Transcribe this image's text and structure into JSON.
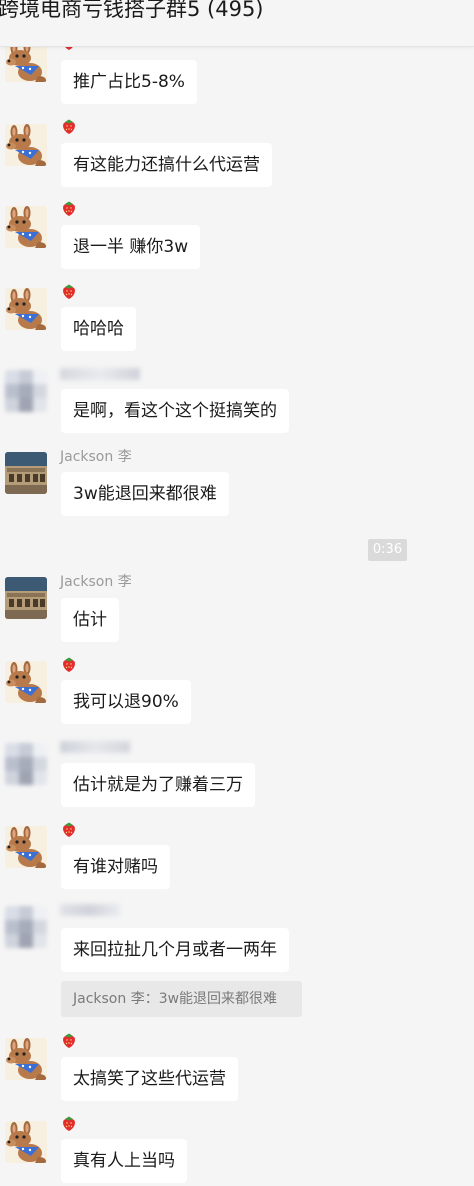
{
  "header": {
    "title": "跨境电商亏钱搭子群5 (495)"
  },
  "colors": {
    "background": "#f5f5f5",
    "bubble": "#ffffff",
    "quote": "#e8e8e8",
    "time_badge": "#dadada",
    "nickname": "#9a9a9a"
  },
  "messages": [
    {
      "sender": "",
      "avatar": "kangaroo-icon",
      "text": "推广占比5-8%"
    },
    {
      "sender": "",
      "avatar": "kangaroo-icon",
      "text": "有这能力还搞什么代运营"
    },
    {
      "sender": "",
      "avatar": "kangaroo-icon",
      "text": "退一半 赚你3w"
    },
    {
      "sender": "",
      "avatar": "kangaroo-icon",
      "text": "哈哈哈"
    },
    {
      "sender": "",
      "avatar": "blurred-avatar",
      "text": "是啊，看这个这个挺搞笑的"
    },
    {
      "sender": "Jackson 李",
      "avatar": "colosseum-icon",
      "text": "3w能退回来都很难"
    },
    {
      "sender": "Jackson 李",
      "avatar": "colosseum-icon",
      "text": "估计"
    },
    {
      "sender": "",
      "avatar": "kangaroo-icon",
      "text": "我可以退90%"
    },
    {
      "sender": "",
      "avatar": "blurred-avatar",
      "text": "估计就是为了赚着三万"
    },
    {
      "sender": "",
      "avatar": "kangaroo-icon",
      "text": "有谁对赌吗"
    },
    {
      "sender": "",
      "avatar": "blurred-avatar",
      "text": "来回拉扯几个月或者一两年"
    },
    {
      "sender": "",
      "avatar": "kangaroo-icon",
      "text": "太搞笑了这些代运营"
    },
    {
      "sender": "",
      "avatar": "kangaroo-icon",
      "text": "真有人上当吗"
    }
  ],
  "time_divider": "0:36",
  "quote": {
    "text": "Jackson 李：3w能退回来都很难"
  }
}
